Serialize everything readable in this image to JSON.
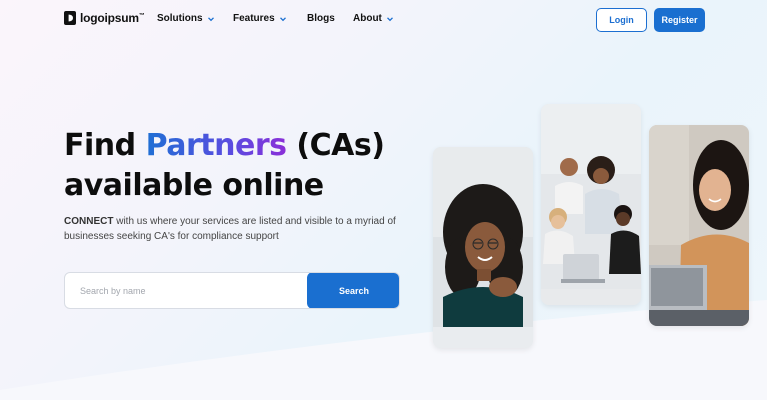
{
  "brand": {
    "name": "logoipsum",
    "mark": "™"
  },
  "nav": {
    "items": [
      {
        "label": "Solutions",
        "has_dropdown": true,
        "icon": "chevron-down-icon"
      },
      {
        "label": "Features",
        "has_dropdown": true,
        "icon": "chevron-down-icon"
      },
      {
        "label": "Blogs",
        "has_dropdown": false
      },
      {
        "label": "About",
        "has_dropdown": true,
        "icon": "chevron-down-icon"
      }
    ]
  },
  "auth": {
    "login_label": "Login",
    "register_label": "Register"
  },
  "hero": {
    "title_line1_before": "Find ",
    "title_accent": "Partners",
    "title_line1_after": " (CAs)",
    "title_line2": "available online",
    "desc_strong": "CONNECT",
    "desc_rest": " with us where your services are listed and visible to a myriad of businesses seeking CA's for compliance support"
  },
  "search": {
    "placeholder": "Search by name",
    "value": "",
    "button_label": "Search"
  },
  "colors": {
    "primary": "#1a6fd0",
    "accent_start": "#1f6fd4",
    "accent_end": "#8a2fd8",
    "text": "#0d0d0d"
  },
  "photos": [
    "smiling-woman-photo",
    "team-laptop-photo",
    "woman-laptop-photo"
  ]
}
